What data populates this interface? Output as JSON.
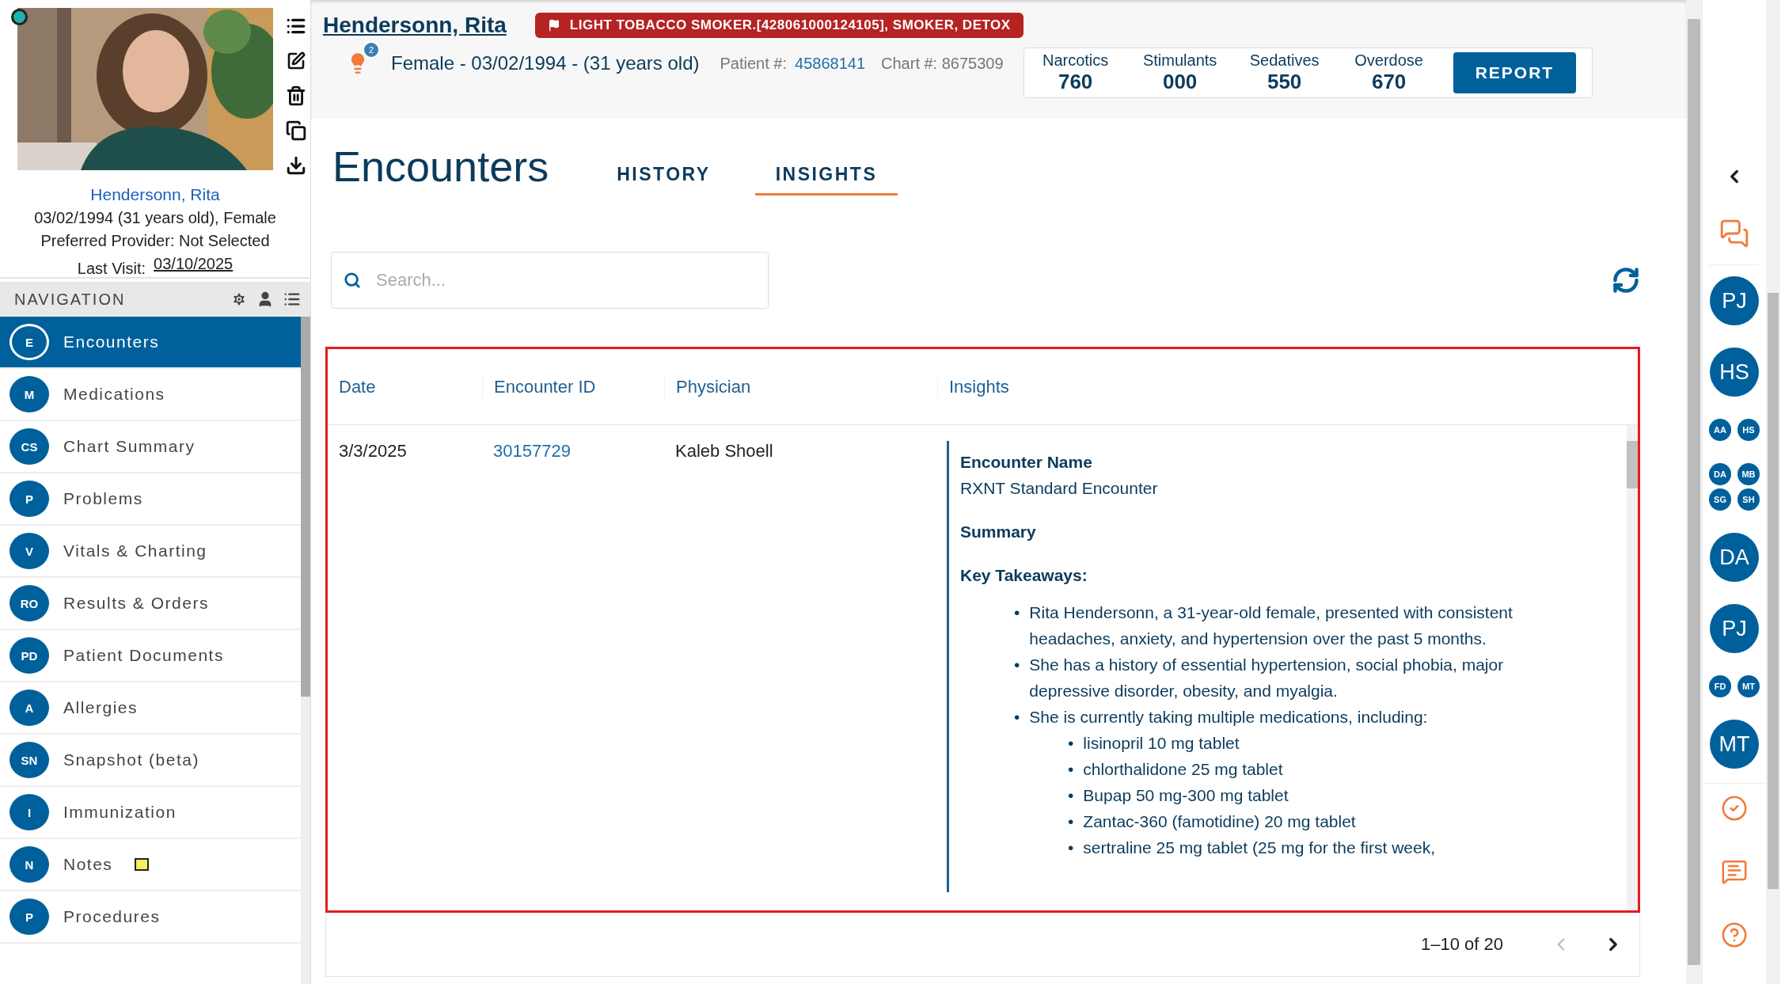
{
  "profile": {
    "name": "Hendersonn, Rita",
    "details": "03/02/1994 (31 years old), Female",
    "provider": "Preferred Provider: Not Selected",
    "last_visit_label": "Last Visit:",
    "last_visit": "03/10/2025"
  },
  "navigation": {
    "title": "NAVIGATION",
    "items": [
      {
        "initials": "E",
        "label": "Encounters",
        "selected": true,
        "note": false
      },
      {
        "initials": "M",
        "label": "Medications",
        "selected": false,
        "note": false
      },
      {
        "initials": "CS",
        "label": "Chart Summary",
        "selected": false,
        "note": false
      },
      {
        "initials": "P",
        "label": "Problems",
        "selected": false,
        "note": false
      },
      {
        "initials": "V",
        "label": "Vitals & Charting",
        "selected": false,
        "note": false
      },
      {
        "initials": "RO",
        "label": "Results & Orders",
        "selected": false,
        "note": false
      },
      {
        "initials": "PD",
        "label": "Patient Documents",
        "selected": false,
        "note": false
      },
      {
        "initials": "A",
        "label": "Allergies",
        "selected": false,
        "note": false
      },
      {
        "initials": "SN",
        "label": "Snapshot (beta)",
        "selected": false,
        "note": false
      },
      {
        "initials": "I",
        "label": "Immunization",
        "selected": false,
        "note": false
      },
      {
        "initials": "N",
        "label": "Notes",
        "selected": false,
        "note": true
      },
      {
        "initials": "P",
        "label": "Procedures",
        "selected": false,
        "note": false
      }
    ]
  },
  "header": {
    "patient_name": "Hendersonn, Rita",
    "flag": "LIGHT TOBACCO SMOKER.[428061000124105], SMOKER, DETOX",
    "alert_count": "2",
    "demographics": "Female - 03/02/1994 - (31 years old)",
    "patient_no_label": "Patient #:",
    "patient_no": "45868141",
    "chart_no": "Chart #: 8675309",
    "stats": [
      {
        "label": "Narcotics",
        "value": "760"
      },
      {
        "label": "Stimulants",
        "value": "000"
      },
      {
        "label": "Sedatives",
        "value": "550"
      },
      {
        "label": "Overdose",
        "value": "670"
      }
    ],
    "report_button": "REPORT"
  },
  "page": {
    "title": "Encounters",
    "tabs": [
      {
        "label": "HISTORY",
        "selected": false
      },
      {
        "label": "INSIGHTS",
        "selected": true
      }
    ]
  },
  "search": {
    "placeholder": "Search..."
  },
  "table": {
    "columns": [
      "Date",
      "Encounter ID",
      "Physician",
      "Insights"
    ],
    "rows": [
      {
        "date": "3/3/2025",
        "encounter_id": "30157729",
        "physician": "Kaleb Shoell",
        "insights": [
          {
            "kind": "heading",
            "text": "Encounter Name"
          },
          {
            "kind": "text",
            "text": "RXNT Standard Encounter"
          },
          {
            "kind": "heading",
            "text": "Summary"
          },
          {
            "kind": "heading",
            "text": "Key Takeaways:"
          },
          {
            "kind": "list",
            "marker": "•",
            "items": [
              {
                "text": "Rita Hendersonn, a 31-year-old female, presented with consistent headaches, anxiety, and hypertension over the past 5 months."
              },
              {
                "text": "She has a history of essential hypertension, social phobia, major depressive disorder, obesity, and myalgia."
              },
              {
                "text": "She is currently taking multiple medications, including:",
                "marker": "•",
                "children": [
                  {
                    "text": "lisinopril 10 mg tablet"
                  },
                  {
                    "text": "chlorthalidone 25 mg tablet"
                  },
                  {
                    "text": "Bupap 50 mg-300 mg tablet"
                  },
                  {
                    "text": "Zantac-360 (famotidine) 20 mg tablet"
                  },
                  {
                    "text": "sertraline 25 mg tablet (25 mg for the first week,"
                  }
                ]
              }
            ]
          }
        ]
      }
    ]
  },
  "pagination": {
    "range": "1–10 of 20",
    "prev_disabled": true
  },
  "sidebar": {
    "groups": [
      {
        "kind": "single",
        "members": [
          "PJ"
        ]
      },
      {
        "kind": "single",
        "members": [
          "HS"
        ]
      },
      {
        "kind": "pair",
        "members": [
          "AA",
          "HS"
        ]
      },
      {
        "kind": "quad",
        "members": [
          "DA",
          "MB",
          "SG",
          "SH"
        ]
      },
      {
        "kind": "single",
        "members": [
          "DA"
        ]
      },
      {
        "kind": "single",
        "members": [
          "PJ"
        ]
      },
      {
        "kind": "pair",
        "members": [
          "FD",
          "MT"
        ]
      },
      {
        "kind": "single",
        "members": [
          "MT"
        ]
      }
    ]
  }
}
